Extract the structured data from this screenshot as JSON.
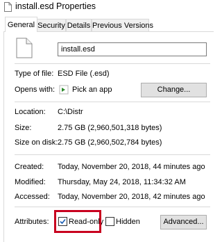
{
  "window": {
    "title": "install.esd Properties",
    "title_icon": "document-icon"
  },
  "tabs": [
    {
      "label": "General",
      "active": true
    },
    {
      "label": "Security",
      "active": false
    },
    {
      "label": "Details",
      "active": false
    },
    {
      "label": "Previous Versions",
      "active": false
    }
  ],
  "general": {
    "file_icon": "document-icon",
    "filename_value": "install.esd",
    "type_label": "Type of file:",
    "type_value": "ESD File (.esd)",
    "opens_label": "Opens with:",
    "opens_value": "Pick an app",
    "opens_icon": "arrow-app-icon",
    "change_button": "Change...",
    "location_label": "Location:",
    "location_value": "C:\\Distr",
    "size_label": "Size:",
    "size_value": "2.75 GB (2,960,501,318 bytes)",
    "size_on_disk_label": "Size on disk:",
    "size_on_disk_value": "2.75 GB (2,960,502,784 bytes)",
    "created_label": "Created:",
    "created_value": "Today, November 20, 2018, 44 minutes ago",
    "modified_label": "Modified:",
    "modified_value": "Thursday, May 24, 2018, 11:34:32 AM",
    "accessed_label": "Accessed:",
    "accessed_value": "Today, November 20, 2018, 42 minutes ago",
    "attributes_label": "Attributes:",
    "readonly_label": "Read-only",
    "readonly_checked": true,
    "hidden_label": "Hidden",
    "hidden_checked": false,
    "advanced_button": "Advanced..."
  },
  "colors": {
    "highlight": "#c8001f",
    "checkbox_check": "#1a5fb4",
    "separator": "#d9d9d9"
  }
}
